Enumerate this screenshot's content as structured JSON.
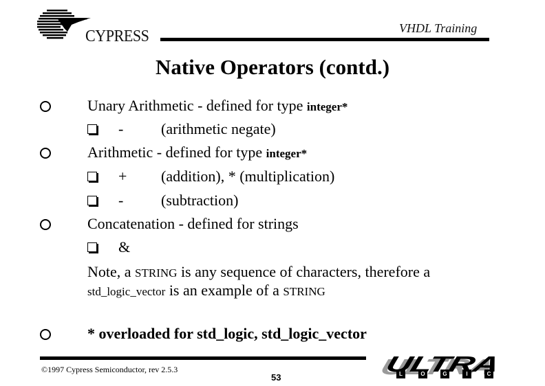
{
  "header": {
    "company_logo_text": "CYPRESS",
    "course_title": "VHDL Training"
  },
  "slide": {
    "title": "Native Operators (contd.)",
    "items": [
      {
        "type": "bullet",
        "text": "Unary Arithmetic - defined for type ",
        "code": "integer*"
      },
      {
        "type": "sub",
        "symbol": "-",
        "text": "(arithmetic negate)"
      },
      {
        "type": "bullet",
        "text": "Arithmetic - defined for type ",
        "code": "integer*"
      },
      {
        "type": "sub",
        "symbol": "+",
        "text": "(addition), * (multiplication)"
      },
      {
        "type": "sub",
        "symbol": "-",
        "text": "(subtraction)"
      },
      {
        "type": "bullet",
        "text": "Concatenation - defined for strings"
      },
      {
        "type": "sub",
        "symbol": "&",
        "text": ""
      }
    ],
    "note": {
      "part1": "Note, a ",
      "string1": "STRING",
      "part2": " is any sequence of characters, therefore a",
      "code": "std_logic_vector",
      "part3": " is an example of a ",
      "string2": "STRING"
    },
    "footnote": "* overloaded for std_logic, std_logic_vector"
  },
  "footer": {
    "copyright": "©1997 Cypress Semiconductor, rev 2.5.3",
    "page_number": "53",
    "brand_word": "ULTRA",
    "brand_letters": [
      "L",
      "O",
      "G",
      "I",
      "C"
    ]
  }
}
